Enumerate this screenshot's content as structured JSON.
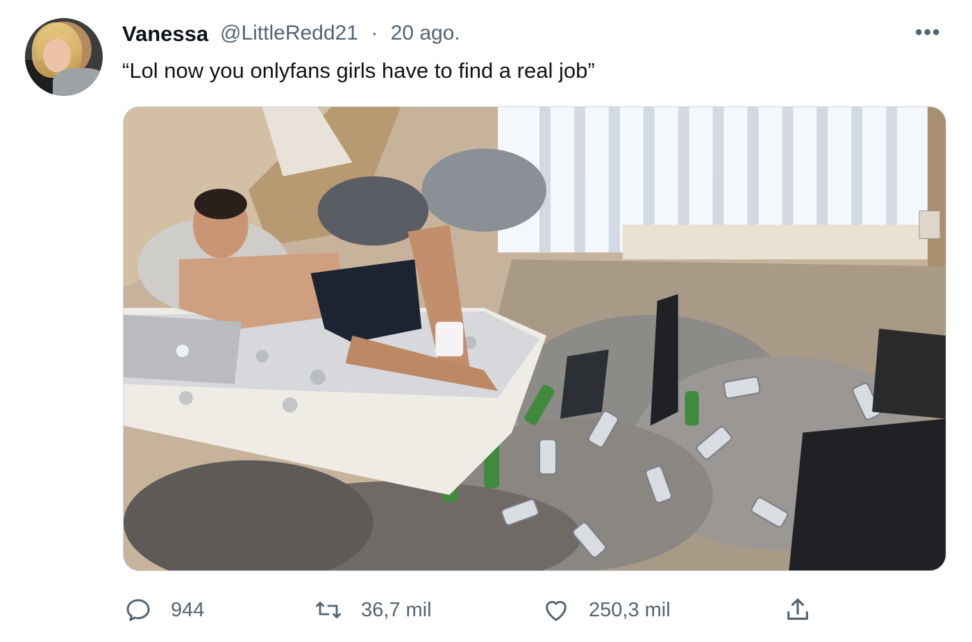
{
  "tweet": {
    "author_name": "Vanessa",
    "author_handle": "@LittleRedd21",
    "separator": "·",
    "date": "20 ago.",
    "more_label": "•••",
    "text": "“Lol now you onlyfans girls have to find a real job”"
  },
  "media": {
    "description_icon": "photo-messy-room"
  },
  "actions": {
    "replies": "944",
    "retweets": "36,7 mil",
    "likes": "250,3 mil"
  },
  "colors": {
    "text_primary": "#0f1419",
    "text_secondary": "#536471",
    "border": "#cfd9de"
  }
}
